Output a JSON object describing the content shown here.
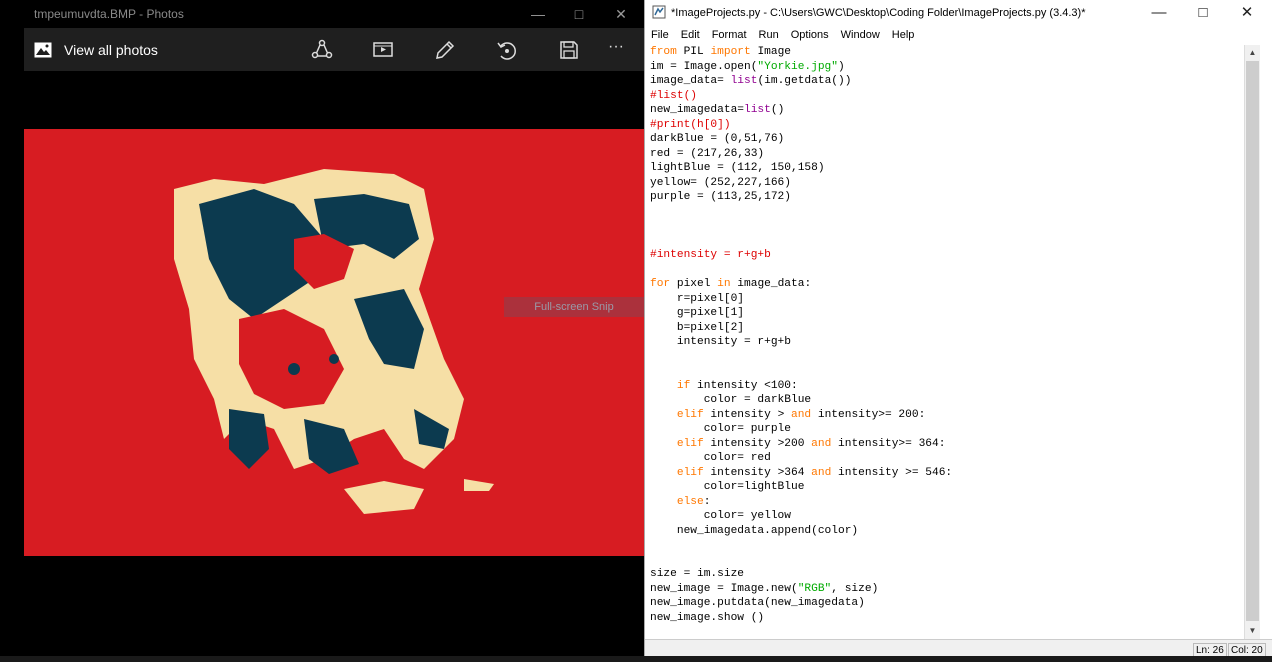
{
  "photos": {
    "window_title": "tmpeumuvdta.BMP - Photos",
    "view_all_label": "View all photos",
    "toolbar_icons": [
      "share-icon",
      "slideshow-icon",
      "edit-pencil-icon",
      "rotate-icon",
      "save-icon",
      "more-icon"
    ],
    "more_label": "···",
    "controls": {
      "minimize": "—",
      "maximize": "□",
      "close": "✕"
    },
    "image_colors": {
      "background": "#d71c22",
      "dark": "#0c3a4f",
      "light": "#f6dfa6"
    }
  },
  "snip_overlay": "Full-screen Snip",
  "idle": {
    "window_title": "*ImageProjects.py - C:\\Users\\GWC\\Desktop\\Coding Folder\\ImageProjects.py (3.4.3)*",
    "controls": {
      "minimize": "—",
      "maximize": "□",
      "close": "✕"
    },
    "menu": [
      "File",
      "Edit",
      "Format",
      "Run",
      "Options",
      "Window",
      "Help"
    ],
    "code_lines": [
      "from PIL import Image",
      "im = Image.open(\"Yorkie.jpg\")",
      "image_data= list(im.getdata())",
      "#list()",
      "new_imagedata=list()",
      "#print(h[0])",
      "darkBlue = (0,51,76)",
      "red = (217,26,33)",
      "lightBlue = (112, 150,158)",
      "yellow= (252,227,166)",
      "purple = (113,25,172)",
      "",
      "",
      "",
      "#intensity = r+g+b",
      "",
      "for pixel in image_data:",
      "    r=pixel[0]",
      "    g=pixel[1]",
      "    b=pixel[2]",
      "    intensity = r+g+b",
      "",
      "",
      "    if intensity <100:",
      "        color = darkBlue",
      "    elif intensity > and intensity>= 200:",
      "        color= purple",
      "    elif intensity >200 and intensity>= 364:",
      "        color= red",
      "    elif intensity >364 and intensity >= 546:",
      "        color=lightBlue",
      "    else:",
      "        color= yellow",
      "    new_imagedata.append(color)",
      "",
      "",
      "size = im.size",
      "new_image = Image.new(\"RGB\", size)",
      "new_image.putdata(new_imagedata)",
      "new_image.show ()"
    ],
    "syntax_colors": {
      "keyword": "#ff7700",
      "builtin": "#900090",
      "string": "#00aa00",
      "comment": "#dd0000"
    },
    "status": {
      "line": "Ln: 26",
      "col": "Col: 20"
    }
  }
}
